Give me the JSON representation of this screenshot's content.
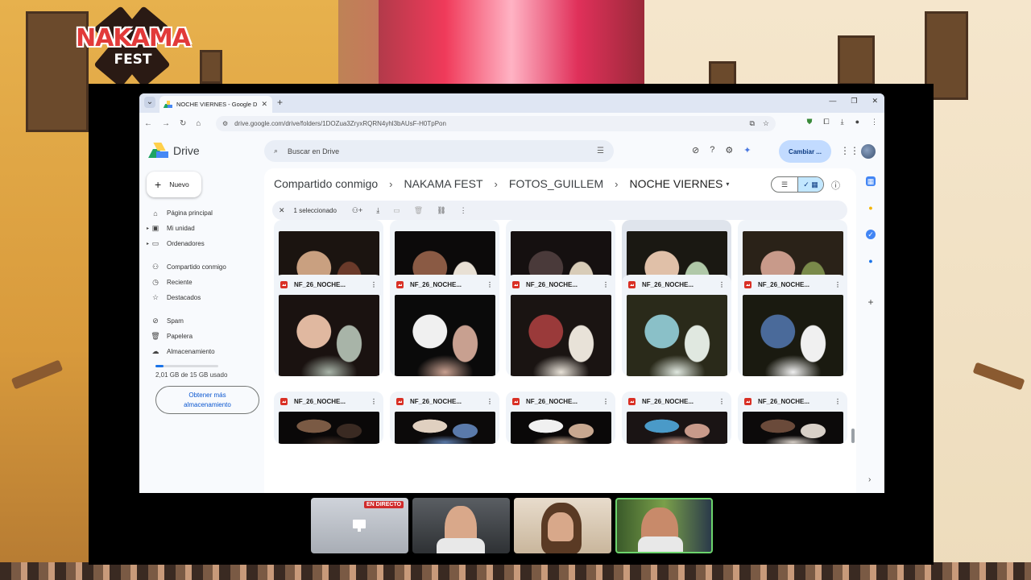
{
  "overlay": {
    "logo_main": "NAKAMA",
    "logo_sub": "FEST"
  },
  "browser": {
    "tab_title": "NOCHE VIERNES - Google Drive",
    "url": "drive.google.com/drive/folders/1DOZua3ZryxRQRN4yhl3bAUsF-H0TpPon"
  },
  "drive": {
    "logo_text": "Drive",
    "search_placeholder": "Buscar en Drive",
    "account_button": "Cambiar ...",
    "new_button": "Nuevo",
    "nav": [
      {
        "label": "Página principal",
        "icon": "home-icon"
      },
      {
        "label": "Mi unidad",
        "icon": "my-drive-icon"
      },
      {
        "label": "Ordenadores",
        "icon": "computers-icon"
      },
      {
        "label": "Compartido conmigo",
        "icon": "shared-icon"
      },
      {
        "label": "Reciente",
        "icon": "clock-icon"
      },
      {
        "label": "Destacados",
        "icon": "star-icon"
      },
      {
        "label": "Spam",
        "icon": "spam-icon"
      },
      {
        "label": "Papelera",
        "icon": "trash-icon"
      },
      {
        "label": "Almacenamiento",
        "icon": "cloud-icon"
      }
    ],
    "storage_used_fraction": 0.134,
    "storage_text": "2,01 GB de 15 GB usado",
    "get_storage_button": "Obtener más almacenamiento",
    "breadcrumb": [
      "Compartido conmigo",
      "NAKAMA FEST",
      "FOTOS_GUILLEM",
      "NOCHE VIERNES"
    ],
    "selection_text": "1 seleccionado",
    "file_name": "NF_26_NOCHE..."
  },
  "stream": {
    "live_badge": "EN DIRECTO"
  },
  "colors": {
    "accent": "#0b57d0",
    "selected_chip": "#c2e7ff",
    "file_icon": "#d93025",
    "live_red": "#d02c2c"
  }
}
